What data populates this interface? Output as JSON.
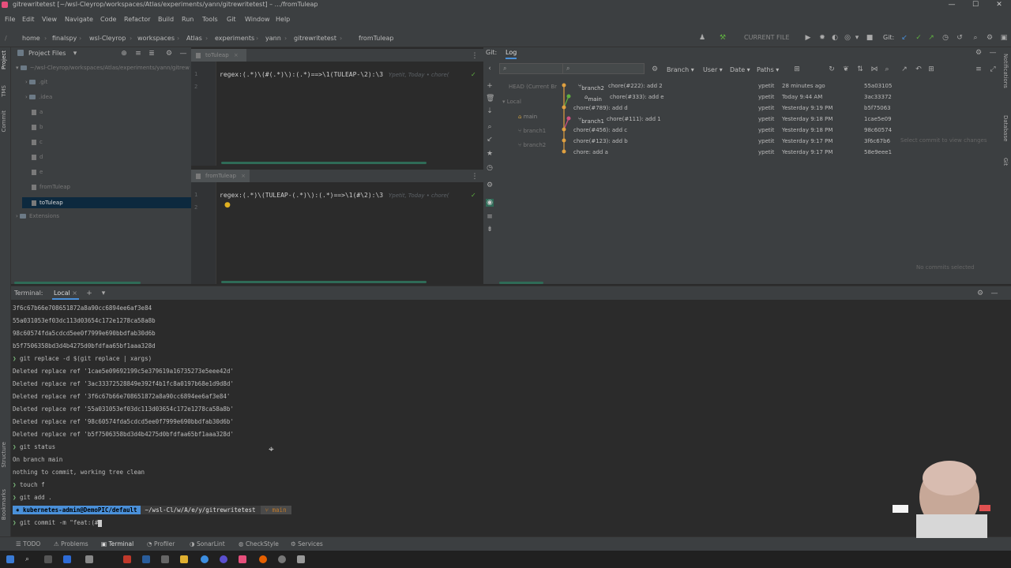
{
  "window": {
    "title": "gitrewritetest [~/wsl-Cleyrop/workspaces/Atlas/experiments/yann/gitrewritetest] – .../fromTuleap",
    "minimize": "—",
    "maximize": "☐",
    "close": "✕"
  },
  "menu": [
    "File",
    "Edit",
    "View",
    "Navigate",
    "Code",
    "Refactor",
    "Build",
    "Run",
    "Tools",
    "Git",
    "Window",
    "Help"
  ],
  "breadcrumb": [
    "home",
    "finalspy",
    "wsl-Cleyrop",
    "workspaces",
    "Atlas",
    "experiments",
    "yann",
    "gitrewritetest",
    "fromTuleap"
  ],
  "navbar": {
    "run_config": "CURRENT FILE",
    "git_label": "Git:"
  },
  "project": {
    "title": "Project Files",
    "root": "~/wsl-Cleyrop/workspaces/Atlas/experiments/yann/gitrewritetest",
    "items": [
      {
        "label": ".git",
        "type": "folder",
        "indent": 1
      },
      {
        "label": ".idea",
        "type": "folder",
        "indent": 1
      },
      {
        "label": "a",
        "type": "file",
        "indent": 2
      },
      {
        "label": "b",
        "type": "file",
        "indent": 2
      },
      {
        "label": "c",
        "type": "file",
        "indent": 2
      },
      {
        "label": "d",
        "type": "file",
        "indent": 2
      },
      {
        "label": "e",
        "type": "file",
        "indent": 2
      },
      {
        "label": "fromTuleap",
        "type": "file",
        "indent": 2
      },
      {
        "label": "toTuleap",
        "type": "file",
        "indent": 2
      },
      {
        "label": "Extensions",
        "type": "folder",
        "indent": 0
      }
    ]
  },
  "editor_top": {
    "tab": "toTuleap",
    "line_no": "1",
    "line_no2": "2",
    "code": "regex:(.*)\\(#(.*)\\):(.*)==>\\1(TULEAP-\\2):\\3",
    "hint": "Ypetit, Today • chore("
  },
  "editor_bottom": {
    "tab": "fromTuleap",
    "line_no": "1",
    "line_no2": "2",
    "code": "regex:(.*)\\(TULEAP-(.*)\\):(.*)==>\\1(#\\2):\\3",
    "hint": "Ypetit, Today • chore("
  },
  "git": {
    "tab_git": "Git:",
    "tab_log": "Log",
    "filters": [
      "Branch",
      "User",
      "Date",
      "Paths"
    ],
    "branches_tree": [
      "HEAD (Current Br",
      "Local",
      "main",
      "branch1",
      "branch2"
    ],
    "commits": [
      {
        "ref": "branch2",
        "message": "chore(#222): add 2",
        "author": "ypetit",
        "date": "28 minutes ago",
        "hash": "55a03105"
      },
      {
        "ref": "main",
        "message": "chore(#333): add e",
        "author": "ypetit",
        "date": "Today 9:44 AM",
        "hash": "3ac33372"
      },
      {
        "ref": "",
        "message": "chore(#789): add d",
        "author": "ypetit",
        "date": "Yesterday 9:19 PM",
        "hash": "b5f75063"
      },
      {
        "ref": "branch1",
        "message": "chore(#111): add 1",
        "author": "ypetit",
        "date": "Yesterday 9:18 PM",
        "hash": "1cae5e09"
      },
      {
        "ref": "",
        "message": "chore(#456): add c",
        "author": "ypetit",
        "date": "Yesterday 9:18 PM",
        "hash": "98c60574"
      },
      {
        "ref": "",
        "message": "chore(#123): add b",
        "author": "ypetit",
        "date": "Yesterday 9:17 PM",
        "hash": "3f6c67b6"
      },
      {
        "ref": "",
        "message": "chore: add a",
        "author": "ypetit",
        "date": "Yesterday 9:17 PM",
        "hash": "58e9eee1"
      }
    ],
    "select_hint": "Select commit to view changes",
    "no_commits": "No commits selected"
  },
  "terminal": {
    "title": "Terminal:",
    "tab": "Local",
    "lines": [
      {
        "text": "3f6c67b66e708651872a8a90cc6894ee6af3e84",
        "prompt": false
      },
      {
        "text": "55a031053ef03dc113d03654c172e1278ca58a8b",
        "prompt": false
      },
      {
        "text": "98c60574fda5cdcd5ee0f7999e690bbdfab30d6b",
        "prompt": false
      },
      {
        "text": "b5f7506358bd3d4b4275d0bfdfaa65bf1aaa328d",
        "prompt": false
      },
      {
        "text": "git replace -d $(git replace | xargs)",
        "prompt": true
      },
      {
        "text": "Deleted replace ref '1cae5e09692199c5e379619a16735273e5eee42d'",
        "prompt": false
      },
      {
        "text": "Deleted replace ref '3ac33372528849e392f4b1fc8a0197b68e1d9d8d'",
        "prompt": false
      },
      {
        "text": "Deleted replace ref '3f6c67b66e708651872a8a90cc6894ee6af3e84'",
        "prompt": false
      },
      {
        "text": "Deleted replace ref '55a031053ef03dc113d03654c172e1278ca58a8b'",
        "prompt": false
      },
      {
        "text": "Deleted replace ref '98c60574fda5cdcd5ee0f7999e690bbdfab30d6b'",
        "prompt": false
      },
      {
        "text": "Deleted replace ref 'b5f7506358bd3d4b4275d0bfdfaa65bf1aaa328d'",
        "prompt": false
      },
      {
        "text": "git status",
        "prompt": true
      },
      {
        "text": "On branch main",
        "prompt": false
      },
      {
        "text": "nothing to commit, working tree clean",
        "prompt": false
      },
      {
        "text": "touch f",
        "prompt": true
      },
      {
        "text": "git add .",
        "prompt": true
      }
    ],
    "prompt_user": "kubernetes-admin@DemoPIC/default",
    "prompt_dir": "~/wsl-Cl/w/A/e/y/gitrewritetest",
    "prompt_branch": "main",
    "current_command": "git  commit -m \"feat:(#"
  },
  "bottom_tools": [
    "TODO",
    "Problems",
    "Terminal",
    "Profiler",
    "SonarLint",
    "CheckStyle",
    "Services"
  ],
  "left_stripe": [
    "Project",
    "TMS",
    "Commit",
    "Structure",
    "Bookmarks"
  ],
  "right_stripe": [
    "Notifications",
    "Database",
    "Git"
  ],
  "colors": {
    "accent": "#4a90d9",
    "graph_green": "#5fb040",
    "graph_orange": "#e0a040",
    "graph_pink": "#d05080"
  }
}
